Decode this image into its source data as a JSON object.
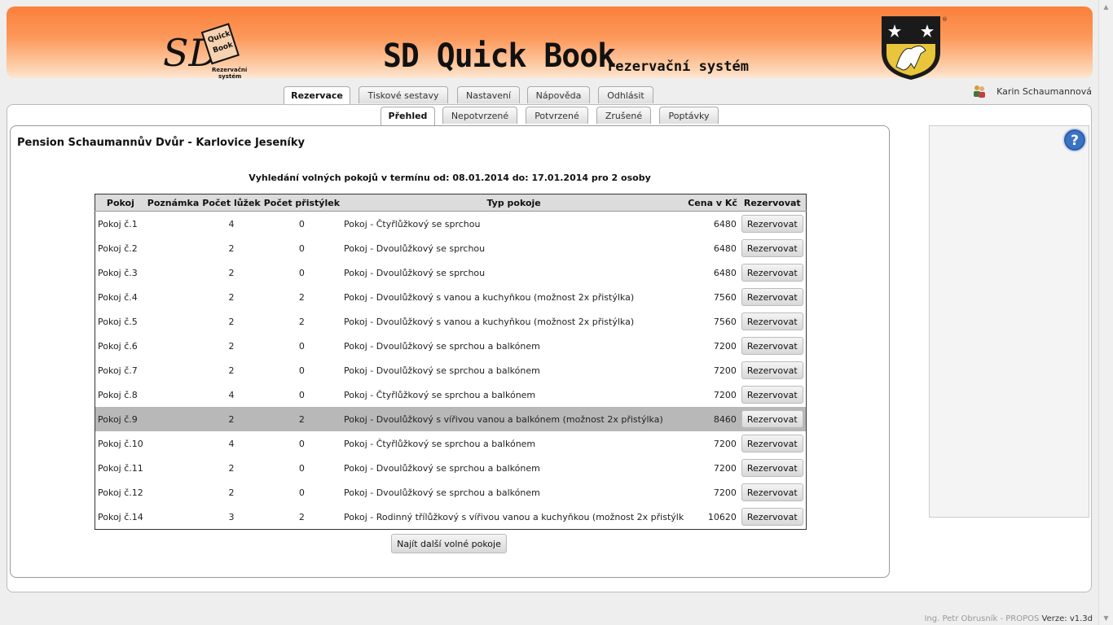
{
  "header": {
    "title": "SD Quick Book",
    "subtitle": "rezervační systém",
    "logo_text": "SD Quick Book Rezervační systém"
  },
  "nav": {
    "main_tabs": [
      {
        "label": "Rezervace",
        "active": true
      },
      {
        "label": "Tiskové sestavy",
        "active": false
      },
      {
        "label": "Nastavení",
        "active": false
      },
      {
        "label": "Nápověda",
        "active": false
      },
      {
        "label": "Odhlásit",
        "active": false
      }
    ],
    "sub_tabs": [
      {
        "label": "Přehled",
        "active": true
      },
      {
        "label": "Nepotvrzené",
        "active": false
      },
      {
        "label": "Potvrzené",
        "active": false
      },
      {
        "label": "Zrušené",
        "active": false
      },
      {
        "label": "Poptávky",
        "active": false
      }
    ]
  },
  "user": {
    "name": "Karin Schaumannová",
    "icon": "users-icon"
  },
  "page": {
    "title": "Pension Schaumannův Dvůr - Karlovice Jeseníky",
    "search_info": "Vyhledání volných pokojů v termínu od: 08.01.2014 do: 17.01.2014 pro 2 osoby"
  },
  "table": {
    "headers": [
      "Pokoj",
      "Poznámka",
      "Počet lůžek",
      "Počet přistýlek",
      "Typ pokoje",
      "Cena v Kč",
      "Rezervovat"
    ],
    "button_label": "Rezervovat",
    "selected_row": 8,
    "rows": [
      {
        "room": "Pokoj č.1",
        "note": "",
        "beds": "4",
        "extra": "0",
        "type": "Pokoj - Čtyřlůžkový se sprchou",
        "price": "6480"
      },
      {
        "room": "Pokoj č.2",
        "note": "",
        "beds": "2",
        "extra": "0",
        "type": "Pokoj - Dvoulůžkový se sprchou",
        "price": "6480"
      },
      {
        "room": "Pokoj č.3",
        "note": "",
        "beds": "2",
        "extra": "0",
        "type": "Pokoj - Dvoulůžkový se sprchou",
        "price": "6480"
      },
      {
        "room": "Pokoj č.4",
        "note": "",
        "beds": "2",
        "extra": "2",
        "type": "Pokoj - Dvoulůžkový s vanou a kuchyňkou (možnost 2x přistýlka)",
        "price": "7560"
      },
      {
        "room": "Pokoj č.5",
        "note": "",
        "beds": "2",
        "extra": "2",
        "type": "Pokoj - Dvoulůžkový s vanou a kuchyňkou (možnost 2x přistýlka)",
        "price": "7560"
      },
      {
        "room": "Pokoj č.6",
        "note": "",
        "beds": "2",
        "extra": "0",
        "type": "Pokoj - Dvoulůžkový se sprchou a balkónem",
        "price": "7200"
      },
      {
        "room": "Pokoj č.7",
        "note": "",
        "beds": "2",
        "extra": "0",
        "type": "Pokoj - Dvoulůžkový se sprchou a balkónem",
        "price": "7200"
      },
      {
        "room": "Pokoj č.8",
        "note": "",
        "beds": "4",
        "extra": "0",
        "type": "Pokoj - Čtyřlůžkový se sprchou a balkónem",
        "price": "7200"
      },
      {
        "room": "Pokoj č.9",
        "note": "",
        "beds": "2",
        "extra": "2",
        "type": "Pokoj - Dvoulůžkový s vířivou vanou a balkónem (možnost 2x přistýlka)",
        "price": "8460"
      },
      {
        "room": "Pokoj č.10",
        "note": "",
        "beds": "4",
        "extra": "0",
        "type": "Pokoj - Čtyřlůžkový se sprchou a balkónem",
        "price": "7200"
      },
      {
        "room": "Pokoj č.11",
        "note": "",
        "beds": "2",
        "extra": "0",
        "type": "Pokoj - Dvoulůžkový se sprchou a balkónem",
        "price": "7200"
      },
      {
        "room": "Pokoj č.12",
        "note": "",
        "beds": "2",
        "extra": "0",
        "type": "Pokoj - Dvoulůžkový se sprchou a balkónem",
        "price": "7200"
      },
      {
        "room": "Pokoj č.14",
        "note": "",
        "beds": "3",
        "extra": "2",
        "type": "Pokoj - Rodinný třílůžkový s vířivou vanou a kuchyňkou (možnost 2x přistýlk",
        "price": "10620"
      }
    ]
  },
  "more_button": "Najít další volné pokoje",
  "footer": {
    "author": "Ing. Petr Obrusník - PROPOS",
    "version": "Verze: v1.3d"
  }
}
